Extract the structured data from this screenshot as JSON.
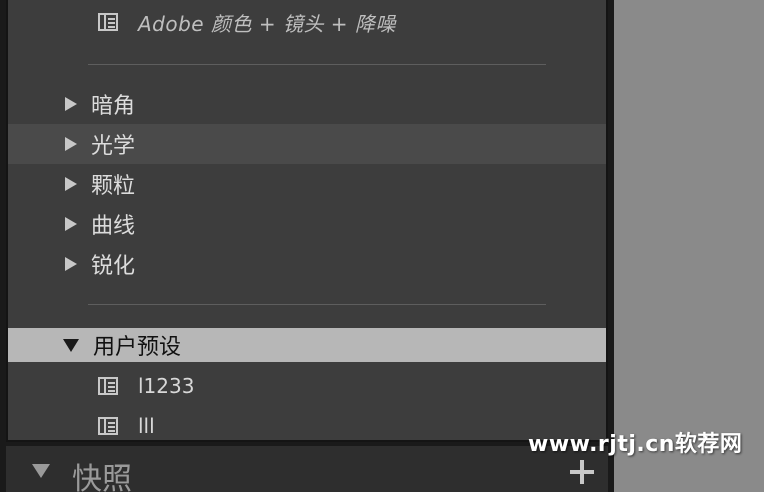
{
  "presets_panel": {
    "top_preset": {
      "label": "Adobe 颜色 + 镜头 + 降噪",
      "icon": "preset-icon"
    },
    "groups": [
      {
        "label": "暗角",
        "state": "collapsed"
      },
      {
        "label": "光学",
        "state": "collapsed"
      },
      {
        "label": "颗粒",
        "state": "collapsed"
      },
      {
        "label": "曲线",
        "state": "collapsed"
      },
      {
        "label": "锐化",
        "state": "collapsed"
      }
    ],
    "user_presets": {
      "label": "用户预设",
      "state": "expanded",
      "items": [
        {
          "label": "l1233",
          "icon": "preset-icon"
        },
        {
          "label": "lll",
          "icon": "preset-icon"
        }
      ]
    }
  },
  "snapshots": {
    "label": "快照",
    "add_icon": "plus-icon"
  },
  "watermark": {
    "text": "www.rjtj.cn软荐网"
  },
  "colors": {
    "panel_bg": "#3d3d3d",
    "selected_row_bg": "#b7b7b7",
    "text": "#dcdcdc",
    "side_bg": "#8a8a8a"
  }
}
